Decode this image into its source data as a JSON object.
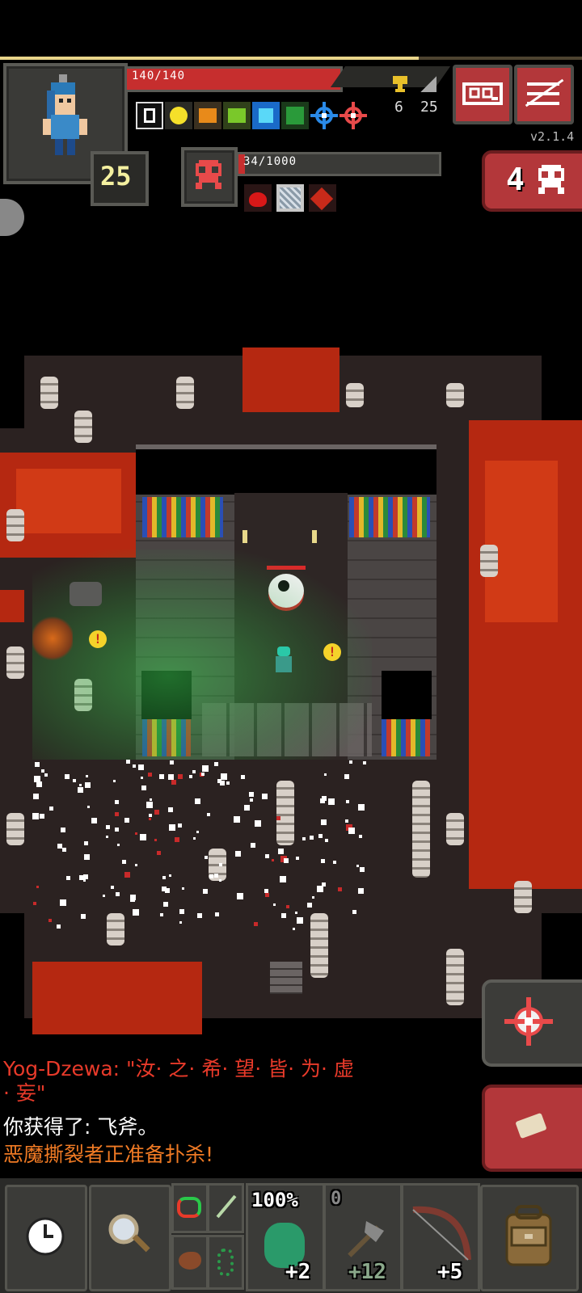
{
  "hero": {
    "hp_text": "140/140",
    "hp_fraction": 1.0,
    "level": "25",
    "exp_fraction": 0.72
  },
  "stats": {
    "gold_count": "6",
    "depth": "25"
  },
  "version": "v2.1.4",
  "enemy": {
    "hp_text": "34/1000",
    "hp_fraction": 0.034
  },
  "danger_count": "4",
  "buff_icons": [
    "blind-icon",
    "light-icon",
    "haste-icon",
    "toxic-icon",
    "frost-icon",
    "mind-icon",
    "target-icon",
    "marked-icon"
  ],
  "enemy_debuffs": [
    "bleeding-icon",
    "frozen-icon",
    "burning-icon"
  ],
  "log": {
    "line1": "Yog-Dzewa: \"汝· 之· 希· 望· 皆· 为· 虚\n· 妄\"",
    "line2": "你获得了: 飞斧。",
    "line3": "恶魔撕裂者正准备扑杀!"
  },
  "toolbar": {
    "quickslot_main_text": "100%",
    "quickslot_main_count": "+2",
    "quickslot_axe_level": "0",
    "quickslot_axe_count": "+12",
    "quickslot_bow_count": "+5"
  },
  "colors": {
    "hp": "#c62e2e",
    "log_red": "#e83a2a",
    "log_orange": "#f07a24",
    "log_white": "#ffffff",
    "lava": "#b52811"
  }
}
